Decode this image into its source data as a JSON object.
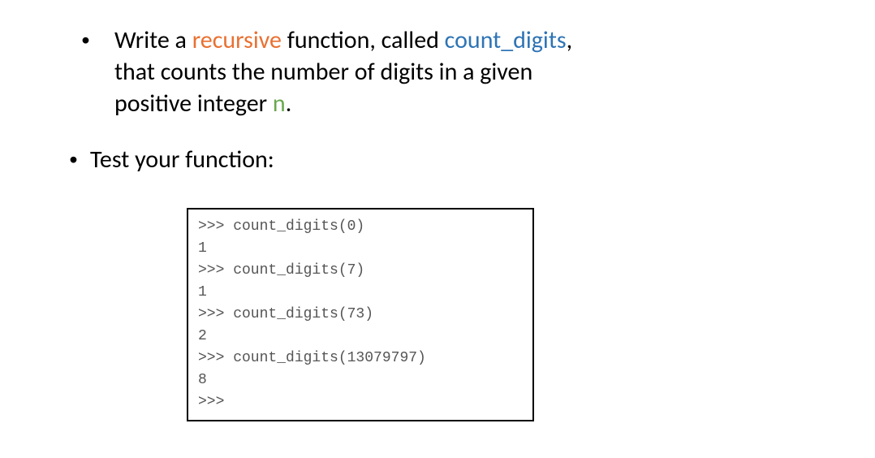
{
  "bullet1": {
    "part1": "Write a ",
    "recursive": "recursive",
    "part2": " function, called ",
    "func_name": "count_digits",
    "part2_end": ",",
    "part3": "that counts the number of digits in a given",
    "part4_pre": "positive integer ",
    "n": "n",
    "part4_post": "."
  },
  "bullet2": {
    "text": "Test your function:"
  },
  "code": {
    "lines": [
      ">>> count_digits(0)",
      "1",
      ">>> count_digits(7)",
      "1",
      ">>> count_digits(73)",
      "2",
      ">>> count_digits(13079797)",
      "8",
      ">>>"
    ]
  }
}
